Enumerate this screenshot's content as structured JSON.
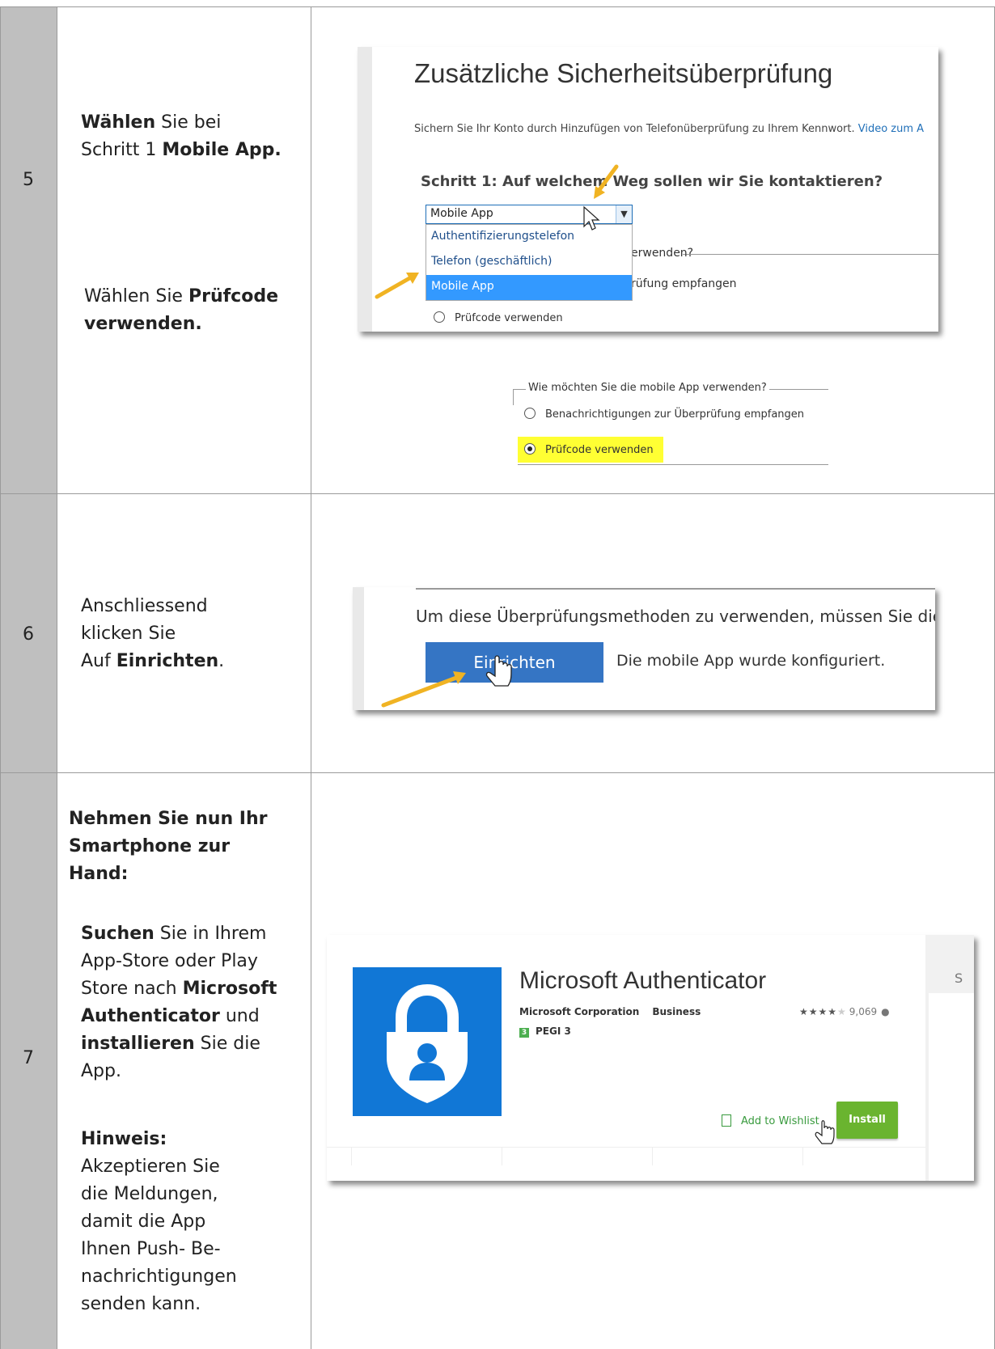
{
  "steps": [
    {
      "number": "5",
      "instruction_a": {
        "bold1": "Wählen",
        "text1": " Sie bei",
        "text2": "Schritt 1 ",
        "bold2": "Mobile App."
      },
      "instruction_b": {
        "text1": "Wählen Sie ",
        "bold1": "Prüfcode",
        "bold2": "verwenden."
      }
    },
    {
      "number": "6",
      "instruction": {
        "line1": "Anschliessend",
        "line2": "klicken Sie",
        "text3": "Auf ",
        "bold3": "Einrichten",
        "text3b": "."
      }
    },
    {
      "number": "7",
      "intro": {
        "line1": "Nehmen Sie nun Ihr",
        "line2": "Smartphone zur",
        "line3": "Hand:"
      },
      "search": {
        "bold1": "Suchen",
        "text1": " Sie in Ihrem",
        "line2": "App-Store oder Play",
        "text3": "Store nach ",
        "bold3": "Microsoft",
        "bold4": "Authenticator",
        "text4": " und",
        "bold5": "installieren",
        "text5": " Sie die",
        "line6": "App."
      },
      "note": {
        "title": "Hinweis:",
        "line1": "Akzeptieren Sie",
        "line2": "die Meldungen,",
        "line3": "damit die App",
        "line4": "Ihnen Push- Be-",
        "line5": "nachrichtigungen",
        "line6": "senden kann."
      }
    }
  ],
  "screenshot1": {
    "title": "Zusätzliche Sicherheitsüberprüfung",
    "subtitle": "Sichern Sie Ihr Konto durch Hinzufügen von Telefonüberprüfung zu Ihrem Kennwort. ",
    "subtitle_link": "Video zum A",
    "step_heading": "Schritt 1: Auf welchem Weg sollen wir Sie kontaktieren?",
    "select_value": "Mobile App",
    "options": [
      "Authentifizierungstelefon",
      "Telefon (geschäftlich)",
      "Mobile App"
    ],
    "partial_fieldset": "erwenden?",
    "partial_option": "rüfung empfangen",
    "radio_label": "Prüfcode verwenden"
  },
  "screenshot2": {
    "legend": "Wie möchten Sie die mobile App verwenden?",
    "option_notify": "Benachrichtigungen zur Überprüfung empfangen",
    "option_code": "Prüfcode verwenden"
  },
  "screenshot3": {
    "text": "Um diese Überprüfungsmethoden zu verwenden, müssen Sie die Micr",
    "button": "Einrichten",
    "status": "Die mobile App wurde konfiguriert."
  },
  "screenshot4": {
    "app_name": "Microsoft Authenticator",
    "developer": "Microsoft Corporation",
    "category": "Business",
    "stars": "★★★★",
    "star_empty": "★",
    "rating_count": "9,069",
    "pegi_badge": "3",
    "pegi": "PEGI 3",
    "wishlist": "Add to Wishlist",
    "install": "Install",
    "edge_letter": "S"
  },
  "colors": {
    "accent_blue": "#3575c4",
    "highlight": "#ffff33",
    "install_green": "#6ab42f",
    "app_icon": "#1177d6",
    "arrow": "#f0b323"
  }
}
